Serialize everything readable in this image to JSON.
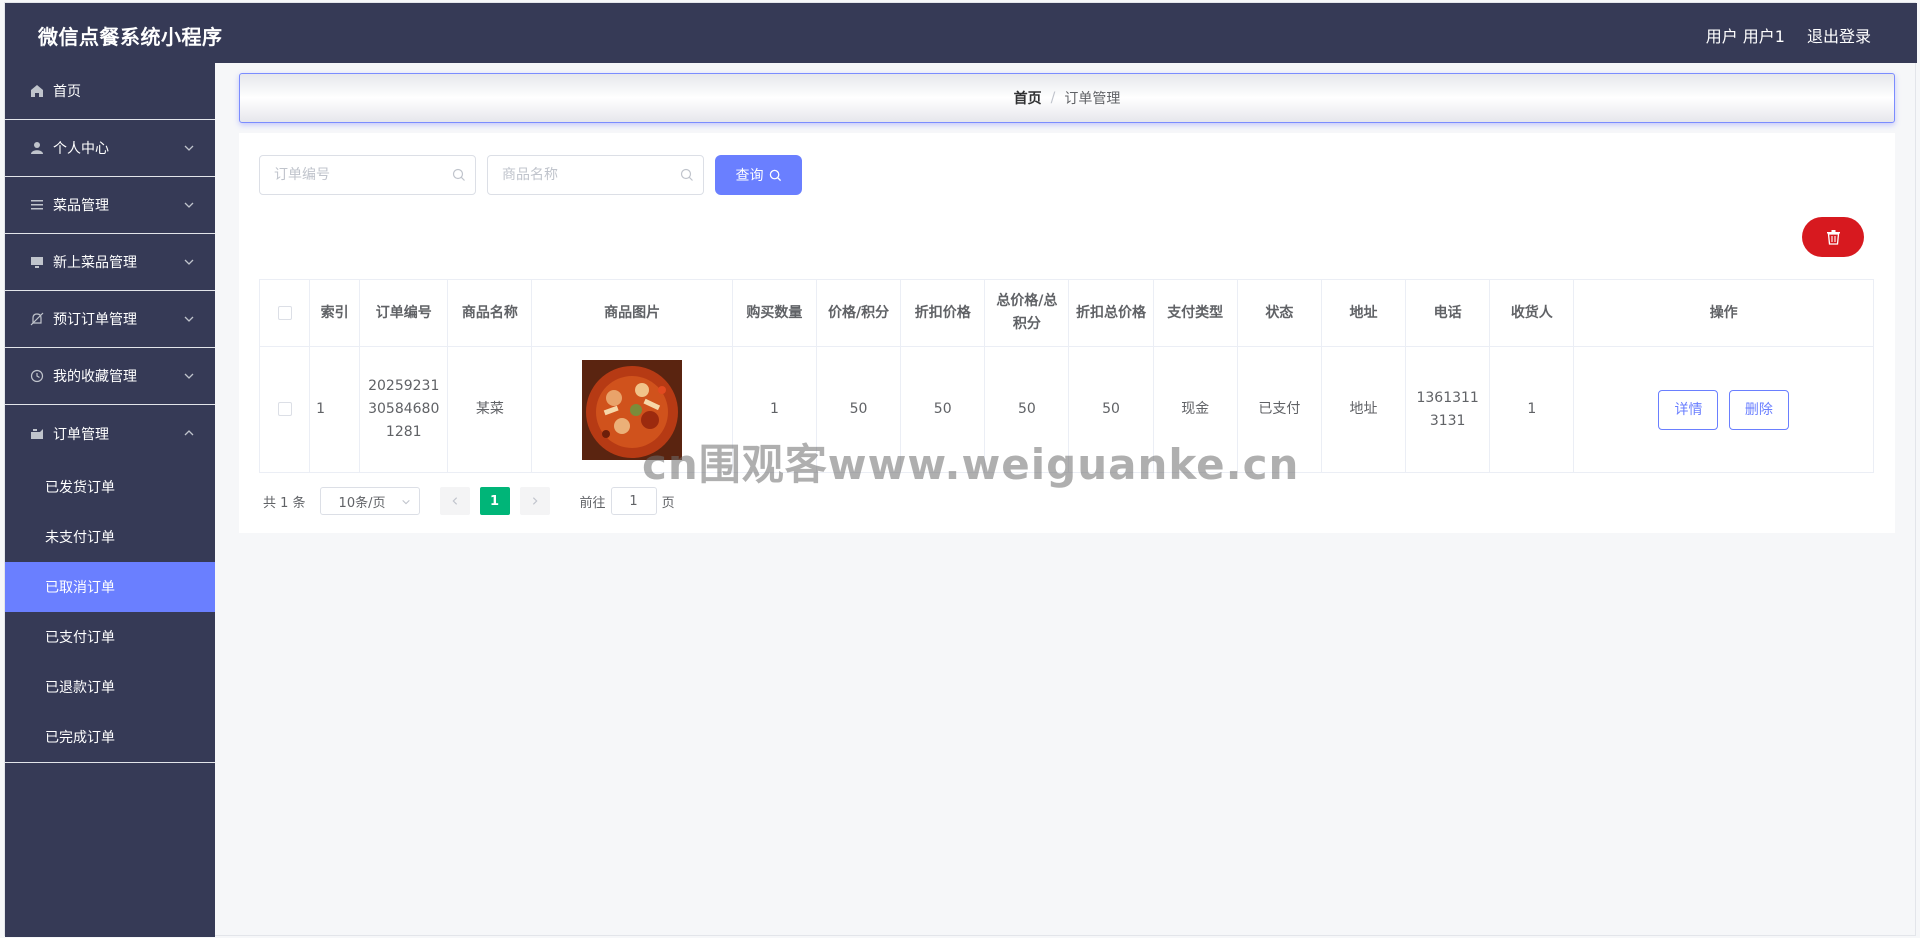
{
  "app": {
    "title": "微信点餐系统小程序"
  },
  "header": {
    "user": "用户 用户1",
    "logout": "退出登录"
  },
  "sidebar": {
    "items": [
      {
        "label": "首页",
        "icon": "home-icon"
      },
      {
        "label": "个人中心",
        "icon": "user-icon"
      },
      {
        "label": "菜品管理",
        "icon": "list-icon"
      },
      {
        "label": "新上菜品管理",
        "icon": "monitor-icon"
      },
      {
        "label": "预订订单管理",
        "icon": "bell-off-icon"
      },
      {
        "label": "我的收藏管理",
        "icon": "clock-icon"
      },
      {
        "label": "订单管理",
        "icon": "megaphone-icon"
      }
    ],
    "sub_items": [
      "已发货订单",
      "未支付订单",
      "已取消订单",
      "已支付订单",
      "已退款订单",
      "已完成订单"
    ],
    "active_sub": "已取消订单"
  },
  "breadcrumb": {
    "home": "首页",
    "sep": "/",
    "current": "订单管理"
  },
  "search": {
    "order_placeholder": "订单编号",
    "product_placeholder": "商品名称",
    "query_label": "查询"
  },
  "table": {
    "headers": [
      "索引",
      "订单编号",
      "商品名称",
      "商品图片",
      "购买数量",
      "价格/积分",
      "折扣价格",
      "总价格/总积分",
      "折扣总价格",
      "支付类型",
      "状态",
      "地址",
      "电话",
      "收货人",
      "操作"
    ],
    "rows": [
      {
        "index": "1",
        "order_no": "2025923130584680 1281",
        "product": "某菜",
        "qty": "1",
        "price": "50",
        "discount_price": "50",
        "total": "50",
        "discount_total": "50",
        "pay_type": "现金",
        "status": "已支付",
        "address": "地址",
        "phone": "13613113131",
        "receiver": "1",
        "detail_label": "详情",
        "delete_label": "删除"
      }
    ]
  },
  "pager": {
    "total": "共 1 条",
    "page_size": "10条/页",
    "current_page": "1",
    "goto_label": "前往",
    "goto_value": "1",
    "page_unit": "页"
  },
  "watermark": "cn围观客www.weiguanke.cn",
  "colors": {
    "nav_bg": "#363a56",
    "accent": "#6a7fff",
    "danger": "#d7191f",
    "pager_active": "#00b578"
  }
}
